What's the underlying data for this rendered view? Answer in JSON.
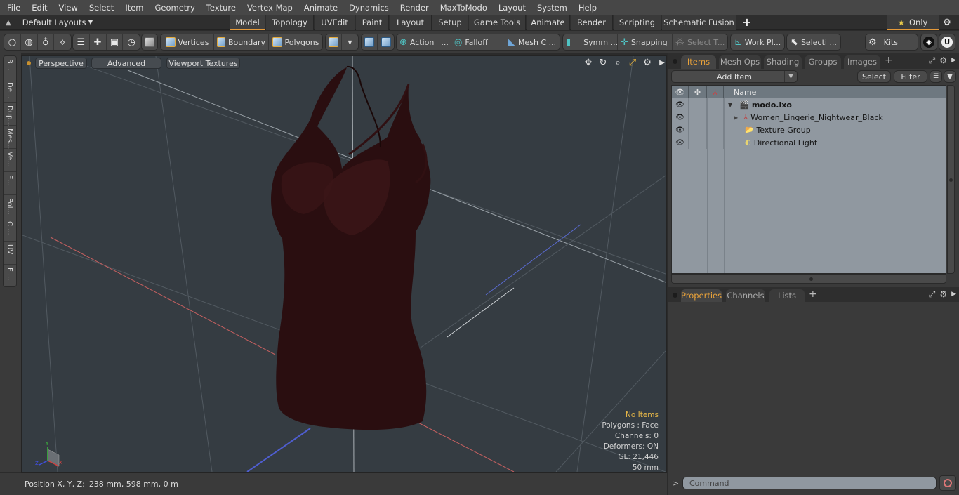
{
  "menubar": {
    "items": [
      "File",
      "Edit",
      "View",
      "Select",
      "Item",
      "Geometry",
      "Texture",
      "Vertex Map",
      "Animate",
      "Dynamics",
      "Render",
      "MaxToModo",
      "Layout",
      "System",
      "Help"
    ]
  },
  "layoutbar": {
    "layout_picker": "Default Layouts",
    "tabs": [
      "Model",
      "Topology",
      "UVEdit",
      "Paint",
      "Layout",
      "Setup",
      "Game Tools",
      "Animate",
      "Render",
      "Scripting",
      "Schematic Fusion"
    ],
    "active_tab": "Model",
    "add_tab": "+",
    "only_label": "Only"
  },
  "toolbar": {
    "vertices": "Vertices",
    "boundary": "Boundary",
    "polygons": "Polygons",
    "action": "Action",
    "action_more": "...",
    "falloff": "Falloff",
    "mesh_c": "Mesh C ...",
    "symm": "Symm ...",
    "snapping": "Snapping",
    "select_t": "Select T...",
    "work_pl": "Work Pl...",
    "selecti": "Selecti ...",
    "kits": "Kits"
  },
  "left_tabs": [
    "B...",
    "De...",
    "Dup...",
    "Mes...",
    "Ve...",
    "E...",
    "Pol...",
    "C ...",
    "UV",
    "F ..."
  ],
  "viewport": {
    "view_mode": "Perspective",
    "shading": "Advanced",
    "textures": "Viewport Textures",
    "stats": {
      "selection": "No Items",
      "polygons": "Polygons : Face",
      "channels": "Channels: 0",
      "deformers": "Deformers: ON",
      "gl": "GL: 21,446",
      "grid": "50 mm"
    },
    "axis_labels": {
      "x": "X",
      "y": "Y",
      "z": "Z"
    }
  },
  "status": {
    "position_label": "Position X, Y, Z:",
    "position_value": "238 mm, 598 mm, 0 m"
  },
  "items_panel": {
    "tabs": [
      "Items",
      "Mesh Ops",
      "Shading",
      "Groups",
      "Images"
    ],
    "active_tab": "Items",
    "add_item": "Add Item",
    "select": "Select",
    "filter": "Filter",
    "name_header": "Name",
    "tree": [
      {
        "name": "modo.lxo",
        "level": 0,
        "expanded": true,
        "bold": true,
        "icon": "scene-icon"
      },
      {
        "name": "Women_Lingerie_Nightwear_Black",
        "level": 1,
        "expanded": false,
        "icon": "mesh-locator-icon"
      },
      {
        "name": "Texture Group",
        "level": 1,
        "icon": "folder-icon"
      },
      {
        "name": "Directional Light",
        "level": 1,
        "icon": "light-icon"
      }
    ]
  },
  "properties_panel": {
    "tabs": [
      "Properties",
      "Channels",
      "Lists"
    ],
    "active_tab": "Properties"
  },
  "command": {
    "prompt": ">",
    "placeholder": "Command"
  },
  "colors": {
    "accent": "#e59a3a",
    "viewport_bg": "#353c42",
    "tree_bg": "#9098a0",
    "stat_highlight": "#e8b848"
  }
}
